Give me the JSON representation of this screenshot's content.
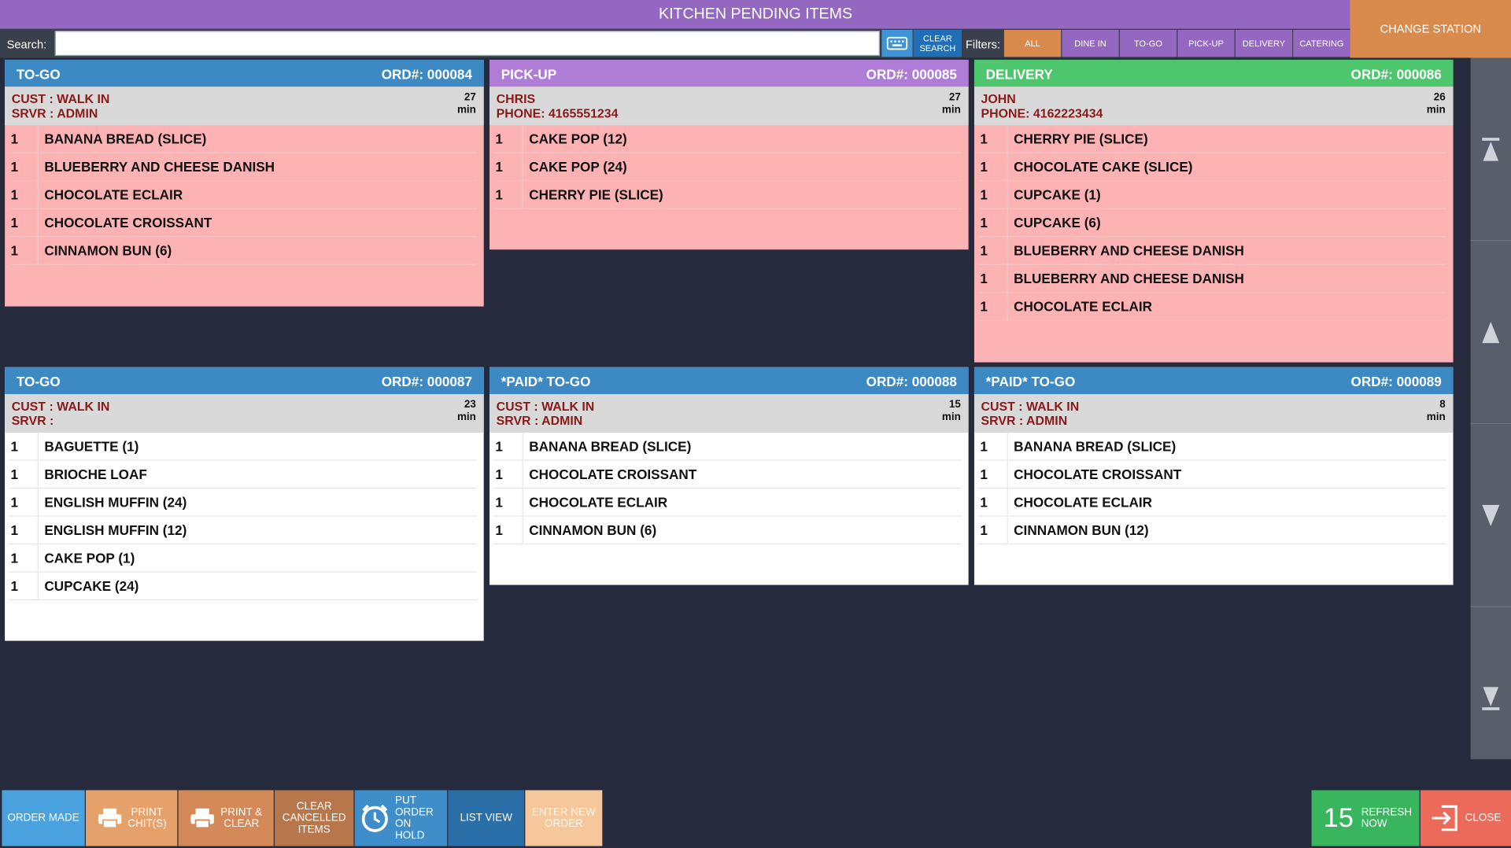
{
  "title": "KITCHEN PENDING ITEMS",
  "change_station": "CHANGE STATION",
  "search": {
    "label": "Search:",
    "value": "",
    "clear_label": "CLEAR SEARCH"
  },
  "filters": {
    "label": "Filters:",
    "items": [
      "ALL",
      "DINE IN",
      "TO-GO",
      "PICK-UP",
      "DELIVERY",
      "CATERING"
    ]
  },
  "orders": [
    {
      "type": "TO-GO",
      "ord": "ORD#: 000084",
      "line1": "CUST : WALK IN",
      "line2": "SRVR : ADMIN",
      "mins": "27",
      "min_unit": "min",
      "color": "#3d89c4",
      "items": [
        {
          "qty": "1",
          "name": "BANANA BREAD (SLICE)"
        },
        {
          "qty": "1",
          "name": "BLUEBERRY AND CHEESE DANISH"
        },
        {
          "qty": "1",
          "name": "CHOCOLATE ECLAIR"
        },
        {
          "qty": "1",
          "name": "CHOCOLATE CROISSANT"
        },
        {
          "qty": "1",
          "name": "CINNAMON BUN (6)"
        }
      ]
    },
    {
      "type": "PICK-UP",
      "ord": "ORD#: 000085",
      "line1": "CHRIS",
      "line2": "PHONE: 4165551234",
      "mins": "27",
      "min_unit": "min",
      "color": "#b07dd6",
      "items": [
        {
          "qty": "1",
          "name": "CAKE POP (12)"
        },
        {
          "qty": "1",
          "name": "CAKE POP (24)"
        },
        {
          "qty": "1",
          "name": "CHERRY PIE (SLICE)"
        }
      ]
    },
    {
      "type": "DELIVERY",
      "ord": "ORD#: 000086",
      "line1": "JOHN",
      "line2": "PHONE: 4162223434",
      "mins": "26",
      "min_unit": "min",
      "color": "#4dc66e",
      "items": [
        {
          "qty": "1",
          "name": "CHERRY PIE (SLICE)"
        },
        {
          "qty": "1",
          "name": "CHOCOLATE CAKE (SLICE)"
        },
        {
          "qty": "1",
          "name": "CUPCAKE (1)"
        },
        {
          "qty": "1",
          "name": "CUPCAKE (6)"
        },
        {
          "qty": "1",
          "name": "BLUEBERRY AND CHEESE DANISH"
        },
        {
          "qty": "1",
          "name": "BLUEBERRY AND CHEESE DANISH"
        },
        {
          "qty": "1",
          "name": "CHOCOLATE ECLAIR"
        }
      ]
    },
    {
      "type": "TO-GO",
      "ord": "ORD#: 000087",
      "line1": "CUST : WALK IN",
      "line2": "SRVR :",
      "mins": "23",
      "min_unit": "min",
      "color": "#3d89c4",
      "items": [
        {
          "qty": "1",
          "name": "BAGUETTE (1)"
        },
        {
          "qty": "1",
          "name": "BRIOCHE LOAF"
        },
        {
          "qty": "1",
          "name": "ENGLISH MUFFIN (24)"
        },
        {
          "qty": "1",
          "name": "ENGLISH MUFFIN (12)"
        },
        {
          "qty": "1",
          "name": "CAKE POP (1)"
        },
        {
          "qty": "1",
          "name": "CUPCAKE (24)"
        }
      ]
    },
    {
      "type": "*PAID* TO-GO",
      "ord": "ORD#: 000088",
      "line1": "CUST : WALK IN",
      "line2": "SRVR : ADMIN",
      "mins": "15",
      "min_unit": "min",
      "color": "#3d89c4",
      "items": [
        {
          "qty": "1",
          "name": "BANANA BREAD (SLICE)"
        },
        {
          "qty": "1",
          "name": "CHOCOLATE CROISSANT"
        },
        {
          "qty": "1",
          "name": "CHOCOLATE ECLAIR"
        },
        {
          "qty": "1",
          "name": "CINNAMON BUN (6)"
        }
      ]
    },
    {
      "type": "*PAID* TO-GO",
      "ord": "ORD#: 000089",
      "line1": "CUST : WALK IN",
      "line2": "SRVR : ADMIN",
      "mins": "8",
      "min_unit": "min",
      "color": "#3d89c4",
      "items": [
        {
          "qty": "1",
          "name": "BANANA BREAD (SLICE)"
        },
        {
          "qty": "1",
          "name": "CHOCOLATE CROISSANT"
        },
        {
          "qty": "1",
          "name": "CHOCOLATE ECLAIR"
        },
        {
          "qty": "1",
          "name": "CINNAMON BUN (12)"
        }
      ]
    }
  ],
  "toolbar": {
    "order_made": "ORDER MADE",
    "print_chits": "PRINT CHIT(S)",
    "print_clear": "PRINT & CLEAR",
    "clear_cancelled": "CLEAR CANCELLED ITEMS",
    "put_on_hold": "PUT ORDER ON HOLD",
    "list_view": "LIST VIEW",
    "enter_new_order": "ENTER NEW ORDER",
    "refresh_count": "15",
    "refresh_label": "REFRESH NOW",
    "close": "CLOSE"
  },
  "colors": {
    "accent_purple": "#9468c0",
    "accent_orange": "#d98a4d",
    "pending_bg": "#fdb3b3",
    "background": "#252a3c"
  }
}
